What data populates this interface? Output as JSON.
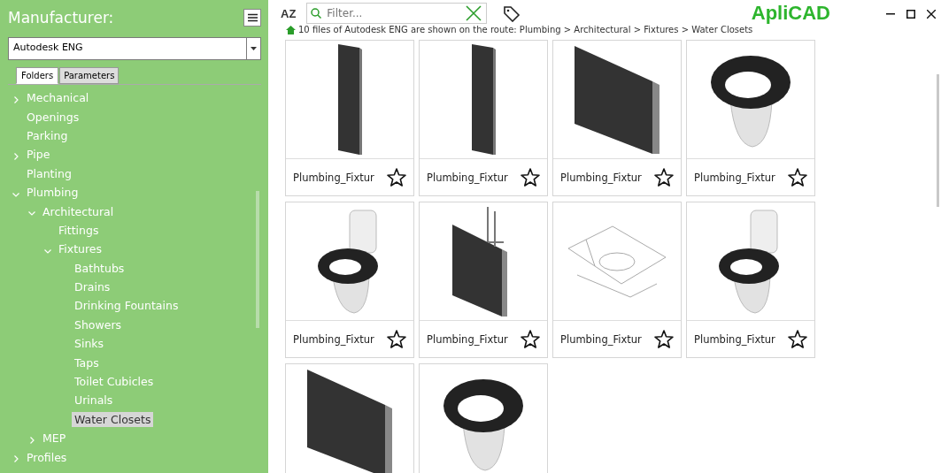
{
  "sidebar": {
    "title": "Manufacturer:",
    "manufacturer": "Autodesk ENG",
    "tabs": [
      {
        "label": "Folders",
        "selected": true
      },
      {
        "label": "Parameters",
        "selected": false
      }
    ],
    "tree": [
      {
        "label": "Mechanical",
        "expanded": false,
        "selected": false
      },
      {
        "label": "Openings",
        "selected": false
      },
      {
        "label": "Parking",
        "selected": false
      },
      {
        "label": "Pipe",
        "expanded": false,
        "selected": false
      },
      {
        "label": "Planting",
        "selected": false
      },
      {
        "label": "Plumbing",
        "expanded": true,
        "selected": false,
        "children": [
          {
            "label": "Architectural",
            "expanded": true,
            "selected": false,
            "children": [
              {
                "label": "Fittings",
                "selected": false
              },
              {
                "label": "Fixtures",
                "expanded": true,
                "selected": false,
                "children": [
                  {
                    "label": "Bathtubs",
                    "selected": false
                  },
                  {
                    "label": "Drains",
                    "selected": false
                  },
                  {
                    "label": "Drinking Fountains",
                    "selected": false
                  },
                  {
                    "label": "Showers",
                    "selected": false
                  },
                  {
                    "label": "Sinks",
                    "selected": false
                  },
                  {
                    "label": "Taps",
                    "selected": false
                  },
                  {
                    "label": "Toilet Cubicles",
                    "selected": false
                  },
                  {
                    "label": "Urinals",
                    "selected": false
                  },
                  {
                    "label": "Water Closets",
                    "selected": true
                  }
                ]
              }
            ]
          },
          {
            "label": "MEP",
            "expanded": false,
            "selected": false
          }
        ]
      },
      {
        "label": "Profiles",
        "expanded": false,
        "selected": false
      }
    ]
  },
  "toolbar": {
    "sort_label": "AZ",
    "filter_placeholder": "Filter...",
    "logo": "ApliCAD"
  },
  "route": "10 files of Autodesk ENG are shown on the route: Plumbing > Architectural > Fixtures > Water Closets",
  "files": [
    {
      "name": "Plumbing_Fixtur",
      "kind": "panel-tall"
    },
    {
      "name": "Plumbing_Fixtur",
      "kind": "panel-tall"
    },
    {
      "name": "Plumbing_Fixtur",
      "kind": "panel-wide"
    },
    {
      "name": "Plumbing_Fixtur",
      "kind": "toilet-seat"
    },
    {
      "name": "Plumbing_Fixtur",
      "kind": "toilet"
    },
    {
      "name": "Plumbing_Fixtur",
      "kind": "panel-grab"
    },
    {
      "name": "Plumbing_Fixtur",
      "kind": "sketch"
    },
    {
      "name": "Plumbing_Fixtur",
      "kind": "toilet"
    },
    {
      "kind": "panel-wide"
    },
    {
      "kind": "toilet-seat"
    }
  ]
}
